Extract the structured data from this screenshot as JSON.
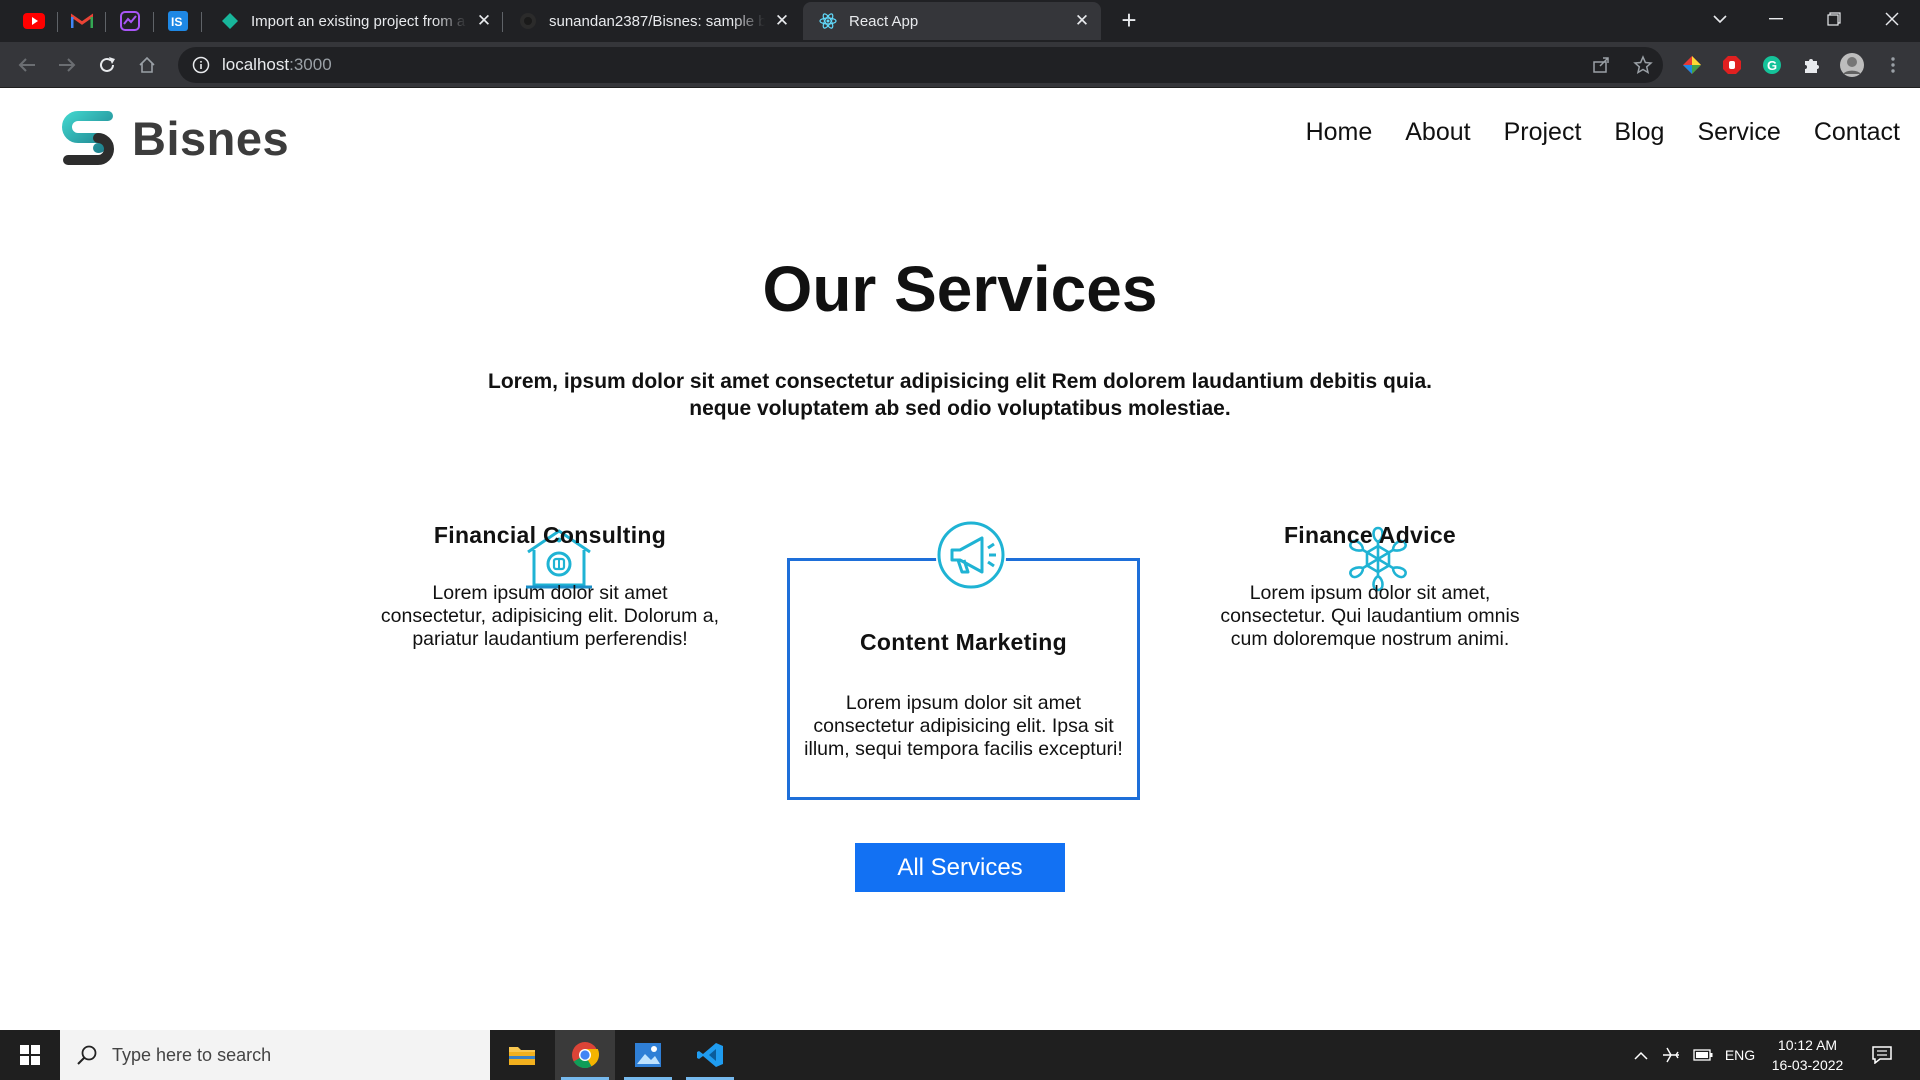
{
  "browser": {
    "tabs": [
      {
        "title": "Import an existing project from a"
      },
      {
        "title": "sunandan2387/Bisnes: sample bu"
      },
      {
        "title": "React App"
      }
    ],
    "url_host": "localhost",
    "url_port": ":3000"
  },
  "site": {
    "brand": "Bisnes",
    "nav": [
      "Home",
      "About",
      "Project",
      "Blog",
      "Service",
      "Contact"
    ],
    "heading": "Our Services",
    "subtext_line1": "Lorem, ipsum dolor sit amet consectetur adipisicing elit Rem dolorem laudantium debitis quia.",
    "subtext_line2": "neque voluptatem ab sed odio voluptatibus molestiae.",
    "services": [
      {
        "title": "Financial Consulting",
        "desc": "Lorem ipsum dolor sit amet consectetur, adipisicing elit. Dolorum a, pariatur laudantium perferendis!",
        "icon": "house-icon"
      },
      {
        "title": "Content Marketing",
        "desc": "Lorem ipsum dolor sit amet consectetur adipisicing elit. Ipsa sit illum, sequi tempora facilis excepturi!",
        "icon": "megaphone-icon"
      },
      {
        "title": "Finance Advice",
        "desc": "Lorem ipsum dolor sit amet, consectetur. Qui laudantium omnis cum doloremque nostrum animi.",
        "icon": "snowflake-icon"
      }
    ],
    "button_label": "All Services",
    "accent_color": "#1271f3",
    "icon_color": "#1fb3d4"
  },
  "taskbar": {
    "search_placeholder": "Type here to search",
    "lang": "ENG",
    "time": "10:12 AM",
    "date": "16-03-2022"
  }
}
